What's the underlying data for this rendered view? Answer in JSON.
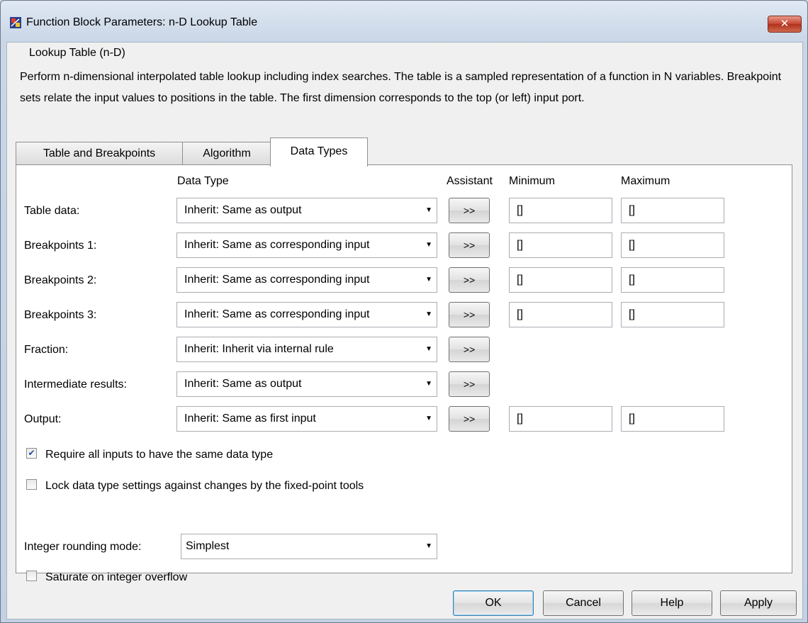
{
  "window": {
    "title": "Function Block Parameters: n-D Lookup Table",
    "close_label": "✕"
  },
  "group": {
    "title": "Lookup Table (n-D)",
    "description": "Perform n-dimensional interpolated table lookup including index searches. The table is a sampled representation of a function in N variables. Breakpoint sets relate the input values to positions in the table. The first dimension corresponds to the top (or left) input port."
  },
  "tabs": [
    {
      "label": "Table and Breakpoints"
    },
    {
      "label": "Algorithm"
    },
    {
      "label": "Data Types"
    }
  ],
  "columns": {
    "data_type": "Data Type",
    "assistant": "Assistant",
    "minimum": "Minimum",
    "maximum": "Maximum"
  },
  "rows": [
    {
      "label": "Table data:",
      "type": "Inherit: Same as output",
      "assist": ">>",
      "min": "[]",
      "max": "[]"
    },
    {
      "label": "Breakpoints 1:",
      "type": "Inherit: Same as corresponding input",
      "assist": ">>",
      "min": "[]",
      "max": "[]"
    },
    {
      "label": "Breakpoints 2:",
      "type": "Inherit: Same as corresponding input",
      "assist": ">>",
      "min": "[]",
      "max": "[]"
    },
    {
      "label": "Breakpoints 3:",
      "type": "Inherit: Same as corresponding input",
      "assist": ">>",
      "min": "[]",
      "max": "[]"
    },
    {
      "label": "Fraction:",
      "type": "Inherit: Inherit via internal rule",
      "assist": ">>"
    },
    {
      "label": "Intermediate results:",
      "type": "Inherit: Same as output",
      "assist": ">>"
    },
    {
      "label": "Output:",
      "type": "Inherit: Same as first input",
      "assist": ">>",
      "min": "[]",
      "max": "[]"
    }
  ],
  "checkboxes": {
    "require_same": {
      "label": "Require all inputs to have the same data type",
      "checked": true
    },
    "lock_settings": {
      "label": "Lock data type settings against changes by the fixed-point tools",
      "checked": false
    },
    "saturate": {
      "label": "Saturate on integer overflow",
      "checked": false
    }
  },
  "rounding": {
    "label": "Integer rounding mode:",
    "value": "Simplest"
  },
  "buttons": {
    "ok": "OK",
    "cancel": "Cancel",
    "help": "Help",
    "apply": "Apply"
  }
}
